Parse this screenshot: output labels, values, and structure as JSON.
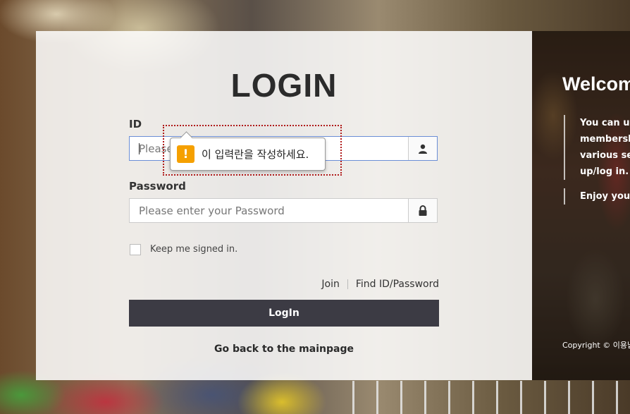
{
  "login": {
    "title": "LOGIN",
    "id_label": "ID",
    "id_placeholder": "Please enter your ID",
    "id_value": "",
    "password_label": "Password",
    "password_placeholder": "Please enter your Password",
    "password_value": "",
    "validation_message": "이 입력란을 작성하세요.",
    "keep_signed_in_label": "Keep me signed in.",
    "keep_signed_in_checked": false,
    "join_link": "Join",
    "find_link": "Find ID/Password",
    "login_button": "LogIn",
    "back_link": "Go back to the mainpage"
  },
  "welcome_panel": {
    "title": "Welcom",
    "items": [
      [
        "You can us",
        "membersh",
        "various ser",
        "up/log in."
      ],
      [
        "Enjoy your"
      ]
    ],
    "copyright": "Copyright © 이용납"
  },
  "icons": {
    "id_addon": "user-icon",
    "password_addon": "lock-icon",
    "validation": "warning-icon"
  },
  "colors": {
    "login_button_bg": "#3c3b44",
    "warning_icon": "#f5a000",
    "highlight_outline": "#b01b1b",
    "focused_border": "#6b8ed6"
  }
}
